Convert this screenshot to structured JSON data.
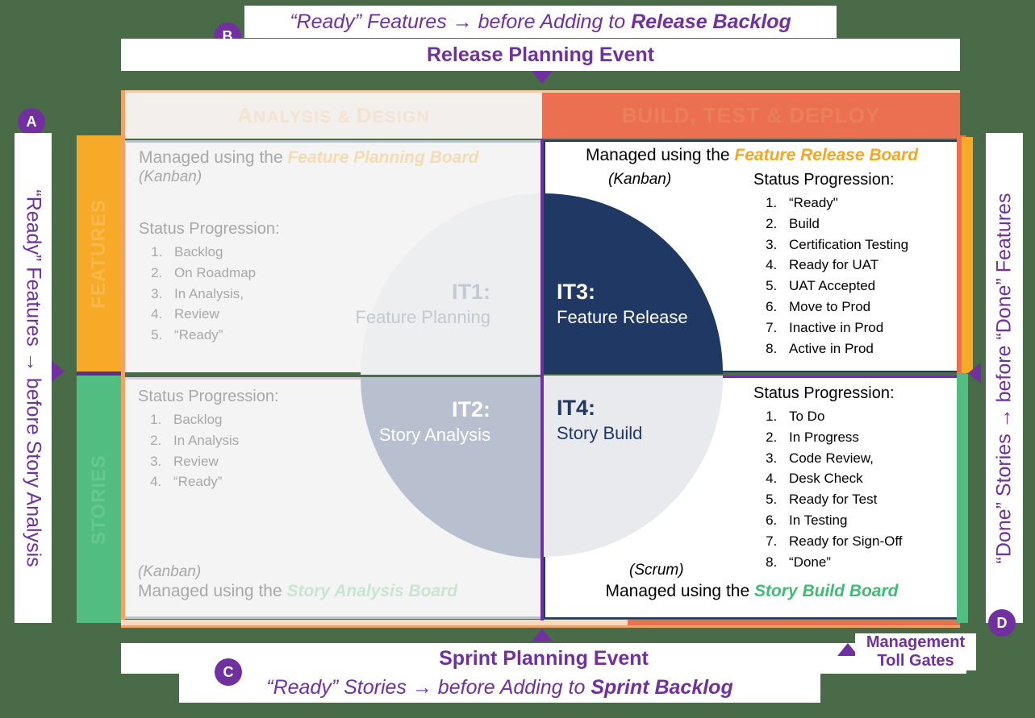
{
  "top_banner": {
    "badge": "B",
    "line1_pre": "“Ready” Features → before Adding to ",
    "line1_em": "Release Backlog",
    "line2": "Release Planning Event"
  },
  "bottom_banner": {
    "badge": "C",
    "line1": "Sprint Planning Event",
    "line2_pre": "“Ready” Stories → before Adding to ",
    "line2_em": "Sprint Backlog"
  },
  "left_banner": {
    "badge": "A",
    "text": "“Ready” Features → before Story Analysis"
  },
  "right_banner": {
    "badge": "D",
    "text": "“Done” Stories → before “Done” Features"
  },
  "bands": {
    "features": "FEATURES",
    "stories": "STORIES"
  },
  "headers": {
    "left_first": "A",
    "left_rest": "NALYSIS & ",
    "left_d": "D",
    "left_tail": "ESIGN",
    "left_full": "ANALYSIS & DESIGN",
    "right_full": "BUILD, TEST & DEPLOY"
  },
  "toll_gates": {
    "line1": "Management",
    "line2": "Toll Gates"
  },
  "quadrants": [
    {
      "id": "IT1",
      "number": "IT1:",
      "name": "Feature Planning",
      "managed_pre": "Managed using the ",
      "board": "Feature Planning Board",
      "method": "(Kanban)",
      "status_title": "Status Progression:",
      "statuses": [
        "Backlog",
        "On Roadmap",
        "In Analysis,",
        "Review",
        "“Ready”"
      ]
    },
    {
      "id": "IT2",
      "number": "IT2:",
      "name": "Story Analysis",
      "managed_pre": "Managed using the ",
      "board": "Story Analysis Board",
      "method": "(Kanban)",
      "status_title": "Status Progression:",
      "statuses": [
        "Backlog",
        "In Analysis",
        "Review",
        "“Ready”"
      ]
    },
    {
      "id": "IT3",
      "number": "IT3:",
      "name": "Feature Release",
      "managed_pre": "Managed using the ",
      "board": "Feature Release Board",
      "method": "(Kanban)",
      "status_title": "Status Progression:",
      "statuses": [
        "“Ready\"",
        "Build",
        "Certification Testing",
        "Ready for UAT",
        "UAT Accepted",
        "Move to Prod",
        "Inactive in Prod",
        "Active in Prod"
      ]
    },
    {
      "id": "IT4",
      "number": "IT4:",
      "name": "Story Build",
      "managed_pre": "Managed using the ",
      "board": "Story Build Board",
      "method": "(Scrum)",
      "status_title": "Status Progression:",
      "statuses": [
        "To Do",
        "In Progress",
        "Code Review,",
        "Desk Check",
        "Ready for Test",
        "In Testing",
        "Ready for Sign-Off",
        "“Done”"
      ]
    }
  ],
  "colors": {
    "purple": "#7030a0",
    "navy": "#1f3864",
    "orange_band": "#f7a928",
    "green_band": "#52bd80",
    "salmon": "#ea7051",
    "gold_text": "#f5a623",
    "green_text": "#3dbd72"
  }
}
